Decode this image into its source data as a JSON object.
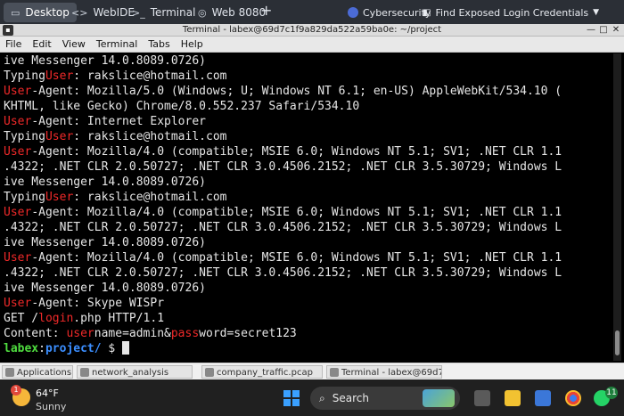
{
  "tabs": [
    {
      "label": "Desktop",
      "icon": "folder-icon"
    },
    {
      "label": "WebIDE",
      "icon": "code-icon"
    },
    {
      "label": "Terminal",
      "icon": "terminal-icon"
    },
    {
      "label": "Web 8080",
      "icon": "globe-icon"
    }
  ],
  "new_tab_label": "+",
  "course": {
    "category": "Cybersecurity",
    "lab": "Find Exposed Login Credentials"
  },
  "window": {
    "title": "Terminal - labex@69d7c1f9a829da522a59ba0e: ~/project"
  },
  "menu": [
    "File",
    "Edit",
    "View",
    "Terminal",
    "Tabs",
    "Help"
  ],
  "terminal": {
    "lines": [
      [
        {
          "t": "ive Messenger 14.0.8089.0726)"
        }
      ],
      [
        {
          "t": "Typing"
        },
        {
          "t": "User",
          "c": "red"
        },
        {
          "t": ": rakslice@hotmail.com"
        }
      ],
      [
        {
          "t": "User",
          "c": "red"
        },
        {
          "t": "-Agent: Mozilla/5.0 (Windows; U; Windows NT 6.1; en-US) AppleWebKit/534.10 ("
        }
      ],
      [
        {
          "t": "KHTML, like Gecko) Chrome/8.0.552.237 Safari/534.10"
        }
      ],
      [
        {
          "t": "User",
          "c": "red"
        },
        {
          "t": "-Agent: Internet Explorer"
        }
      ],
      [
        {
          "t": "Typing"
        },
        {
          "t": "User",
          "c": "red"
        },
        {
          "t": ": rakslice@hotmail.com"
        }
      ],
      [
        {
          "t": "User",
          "c": "red"
        },
        {
          "t": "-Agent: Mozilla/4.0 (compatible; MSIE 6.0; Windows NT 5.1; SV1; .NET CLR 1.1"
        }
      ],
      [
        {
          "t": ".4322; .NET CLR 2.0.50727; .NET CLR 3.0.4506.2152; .NET CLR 3.5.30729; Windows L"
        }
      ],
      [
        {
          "t": "ive Messenger 14.0.8089.0726)"
        }
      ],
      [
        {
          "t": "Typing"
        },
        {
          "t": "User",
          "c": "red"
        },
        {
          "t": ": rakslice@hotmail.com"
        }
      ],
      [
        {
          "t": "User",
          "c": "red"
        },
        {
          "t": "-Agent: Mozilla/4.0 (compatible; MSIE 6.0; Windows NT 5.1; SV1; .NET CLR 1.1"
        }
      ],
      [
        {
          "t": ".4322; .NET CLR 2.0.50727; .NET CLR 3.0.4506.2152; .NET CLR 3.5.30729; Windows L"
        }
      ],
      [
        {
          "t": "ive Messenger 14.0.8089.0726)"
        }
      ],
      [
        {
          "t": "User",
          "c": "red"
        },
        {
          "t": "-Agent: Mozilla/4.0 (compatible; MSIE 6.0; Windows NT 5.1; SV1; .NET CLR 1.1"
        }
      ],
      [
        {
          "t": ".4322; .NET CLR 2.0.50727; .NET CLR 3.0.4506.2152; .NET CLR 3.5.30729; Windows L"
        }
      ],
      [
        {
          "t": "ive Messenger 14.0.8089.0726)"
        }
      ],
      [
        {
          "t": "User",
          "c": "red"
        },
        {
          "t": "-Agent: Skype WISPr"
        }
      ],
      [
        {
          "t": "GET /"
        },
        {
          "t": "login",
          "c": "red"
        },
        {
          "t": ".php HTTP/1.1"
        }
      ],
      [
        {
          "t": "Content: "
        },
        {
          "t": "user",
          "c": "red"
        },
        {
          "t": "name=admin&"
        },
        {
          "t": "pass",
          "c": "red"
        },
        {
          "t": "word=secret123"
        }
      ]
    ],
    "prompt": {
      "user": "labex",
      "sep": ":",
      "path": "project/",
      "symbol": " $ "
    }
  },
  "strip_items": [
    "Applications",
    "network_analysis",
    "company_traffic.pcap",
    "Terminal - labex@69d7c"
  ],
  "weather": {
    "badge": "1",
    "temp": "64°F",
    "condition": "Sunny"
  },
  "search": {
    "label": "Search"
  },
  "notification_count": "11",
  "colors": {
    "prompt_user": "#4fdc3f",
    "prompt_path": "#3b8eff",
    "match": "#ef2929"
  }
}
